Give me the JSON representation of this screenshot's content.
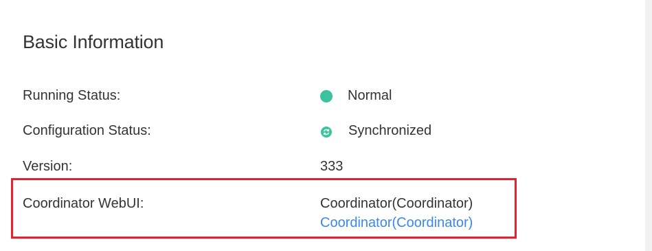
{
  "section": {
    "title": "Basic Information"
  },
  "rows": {
    "running_status": {
      "label": "Running Status:",
      "value": "Normal",
      "status_color": "#3bc3a0",
      "icon": "status-dot-icon"
    },
    "configuration_status": {
      "label": "Configuration Status:",
      "value": "Synchronized",
      "status_color": "#3bc3a0",
      "icon": "sync-icon"
    },
    "version": {
      "label": "Version:",
      "value": "333"
    },
    "coordinator_webui": {
      "label": "Coordinator WebUI:",
      "value_text": "Coordinator(Coordinator)",
      "value_link": "Coordinator(Coordinator)",
      "link_color": "#3b87e8",
      "highlight_color": "#e8202d"
    }
  }
}
